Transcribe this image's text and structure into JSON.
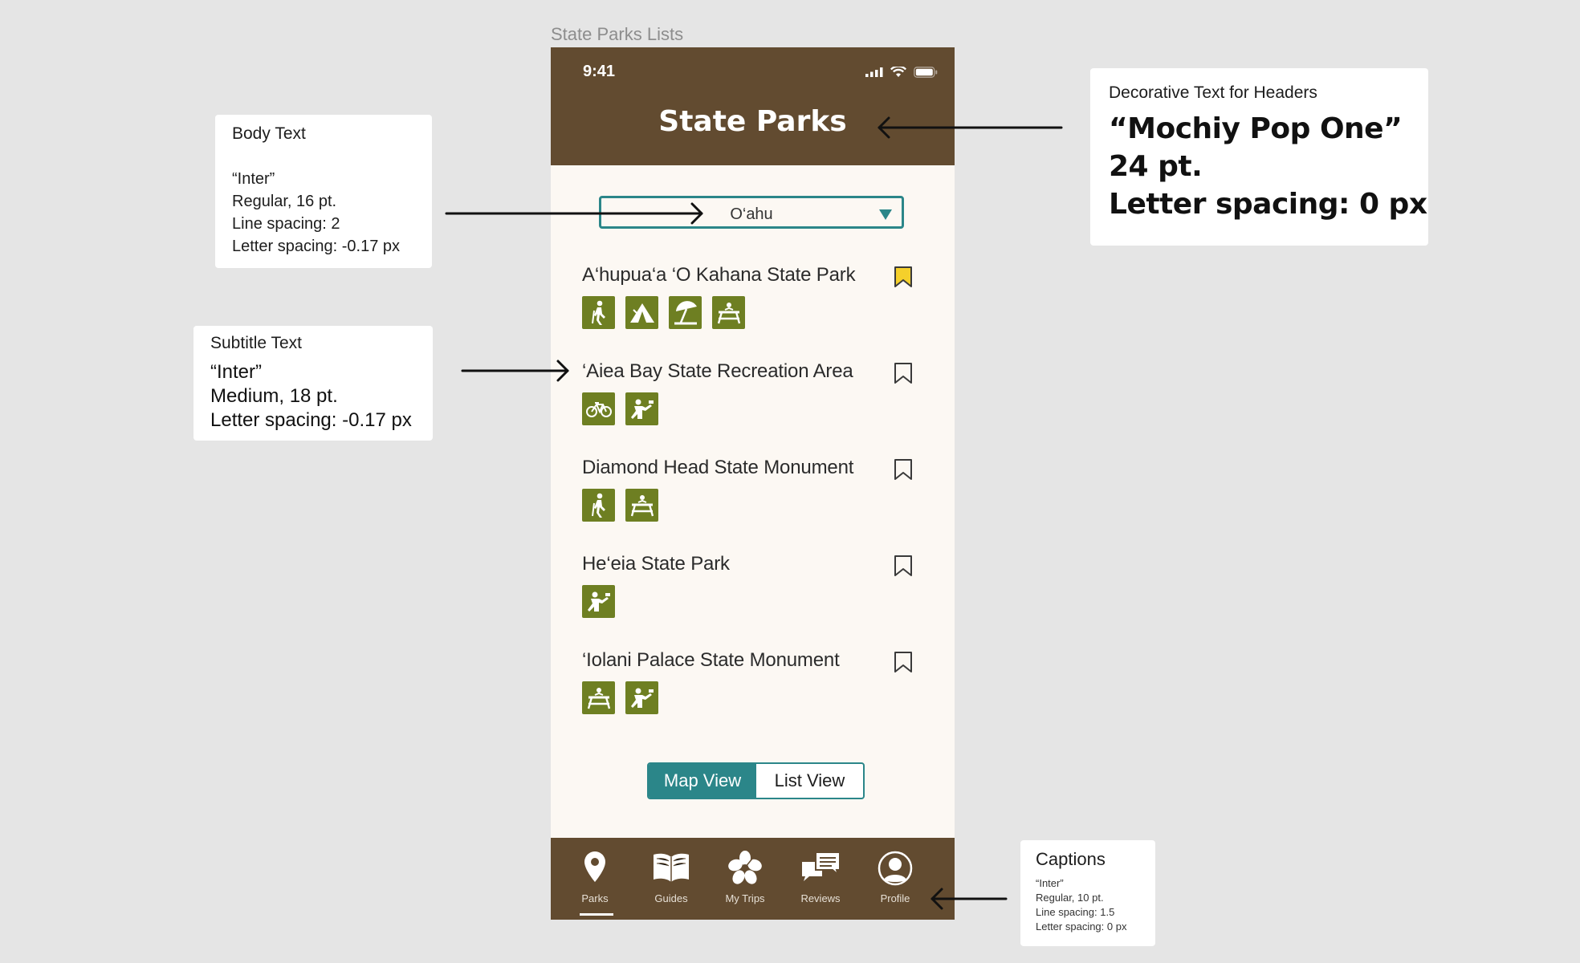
{
  "canvas": {
    "frame_label": "State Parks Lists"
  },
  "status_bar": {
    "time": "9:41"
  },
  "header": {
    "title": "State Parks"
  },
  "island_select": {
    "value": "O‘ahu"
  },
  "parks": [
    {
      "name": "A‘hupua‘a ‘O Kahana State Park",
      "bookmarked": true,
      "amenities": [
        "hiking-icon",
        "camping-icon",
        "beach-icon",
        "picnic-icon"
      ]
    },
    {
      "name": "‘Aiea Bay State Recreation Area",
      "bookmarked": false,
      "amenities": [
        "biking-icon",
        "scenic-view-icon"
      ]
    },
    {
      "name": "Diamond Head State Monument",
      "bookmarked": false,
      "amenities": [
        "hiking-icon",
        "picnic-icon"
      ]
    },
    {
      "name": "He‘eia State Park",
      "bookmarked": false,
      "amenities": [
        "scenic-view-icon"
      ]
    },
    {
      "name": "‘Iolani Palace State Monument",
      "bookmarked": false,
      "amenities": [
        "picnic-icon",
        "scenic-view-icon"
      ]
    }
  ],
  "view_toggle": {
    "map_label": "Map View",
    "list_label": "List View",
    "active": "Map View"
  },
  "tab_bar": {
    "tabs": [
      {
        "label": "Parks",
        "icon": "location-pin-icon",
        "active": true
      },
      {
        "label": "Guides",
        "icon": "book-icon",
        "active": false
      },
      {
        "label": "My Trips",
        "icon": "hibiscus-icon",
        "active": false
      },
      {
        "label": "Reviews",
        "icon": "chat-icon",
        "active": false
      },
      {
        "label": "Profile",
        "icon": "profile-icon",
        "active": false
      }
    ]
  },
  "annotations": {
    "body_text": {
      "title": "Body Text",
      "font": "“Inter”",
      "weight": "Regular, 16 pt.",
      "line_spacing": "Line spacing: 2",
      "letter_spacing": "Letter spacing: -0.17 px"
    },
    "subtitle_text": {
      "title": "Subtitle Text",
      "font": "“Inter”",
      "weight": "Medium, 18 pt.",
      "letter_spacing": "Letter spacing: -0.17 px"
    },
    "decorative_text": {
      "title": "Decorative Text for Headers",
      "font": "“Mochiy Pop One”",
      "size": "24 pt.",
      "letter_spacing": "Letter spacing: 0 px"
    },
    "captions": {
      "title": "Captions",
      "font": "“Inter”",
      "weight": "Regular, 10 pt.",
      "line_spacing": "Line spacing: 1.5",
      "letter_spacing": "Letter spacing: 0 px"
    }
  },
  "colors": {
    "header_brown": "#624b30",
    "accent_teal": "#2b8689",
    "amenity_green": "#6e7f22",
    "bookmark_yellow": "#f5d02b",
    "background": "#fcf8f3"
  }
}
